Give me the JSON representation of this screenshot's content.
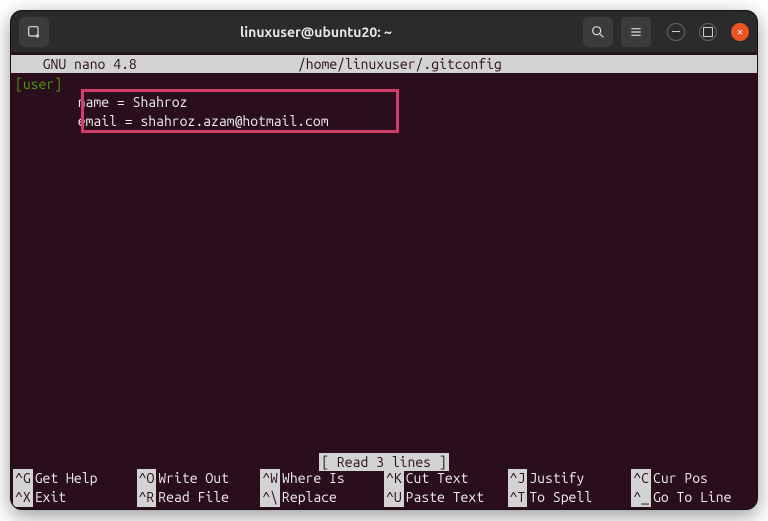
{
  "titlebar": {
    "title": "linuxuser@ubuntu20: ~"
  },
  "nano": {
    "app": "  GNU nano 4.8",
    "path": "/home/linuxuser/.gitconfig",
    "section": "[user]",
    "line1": "        name = Shahroz",
    "line2": "        email = shahroz.azam@hotmail.com",
    "status": "[ Read 3 lines ]"
  },
  "shortcuts": {
    "r1c1k": "^G",
    "r1c1t": "Get Help",
    "r1c2k": "^O",
    "r1c2t": "Write Out",
    "r1c3k": "^W",
    "r1c3t": "Where Is",
    "r1c4k": "^K",
    "r1c4t": "Cut Text",
    "r1c5k": "^J",
    "r1c5t": "Justify",
    "r1c6k": "^C",
    "r1c6t": "Cur Pos",
    "r2c1k": "^X",
    "r2c1t": "Exit",
    "r2c2k": "^R",
    "r2c2t": "Read File",
    "r2c3k": "^\\",
    "r2c3t": "Replace",
    "r2c4k": "^U",
    "r2c4t": "Paste Text",
    "r2c5k": "^T",
    "r2c5t": "To Spell",
    "r2c6k": "^_",
    "r2c6t": "Go To Line"
  }
}
